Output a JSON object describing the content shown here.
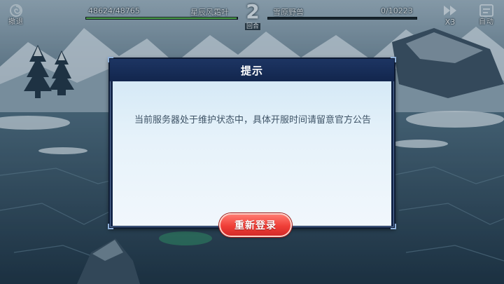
{
  "hud": {
    "retreat_label": "撤退",
    "speed_label": "X3",
    "auto_label": "自动",
    "player": {
      "hp_text": "48624/48765",
      "hp_fraction": 0.997,
      "name": "星辰风霜叶"
    },
    "enemy": {
      "hp_text": "0/10223",
      "hp_fraction": 0.0,
      "name": "雪原野兽"
    },
    "round": {
      "number": "2",
      "label": "回合"
    }
  },
  "dialog": {
    "title": "提示",
    "message": "当前服务器处于维护状态中，具体开服时间请留意官方公告",
    "button_label": "重新登录"
  },
  "colors": {
    "dialog_header": "#14274a",
    "dialog_body": "#e6f2fa",
    "button_red": "#ef3e37",
    "hp_green": "#5bc24f"
  },
  "icons": {
    "retreat": "swirl-icon",
    "speed": "fast-forward-icon",
    "auto": "auto-battle-icon"
  }
}
